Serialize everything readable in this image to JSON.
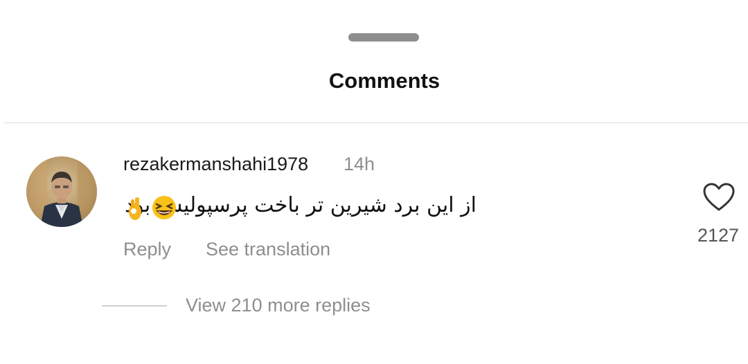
{
  "sheet": {
    "title": "Comments"
  },
  "comment": {
    "username": "rezakermanshahi1978",
    "timestamp": "14h",
    "text": "از این برد شیرین تر باخت پرسپولیس بود",
    "emoji": [
      "grinning-squinting-face",
      "ok-hand"
    ],
    "reply_label": "Reply",
    "translate_label": "See translation",
    "like_count": "2127",
    "view_replies_label": "View 210 more replies"
  },
  "icons": {
    "like": "heart-icon"
  },
  "colors": {
    "primary_text": "#111111",
    "secondary_text": "#8e8e8e",
    "divider": "#dcdcdc",
    "handle": "#8e8e8e"
  }
}
